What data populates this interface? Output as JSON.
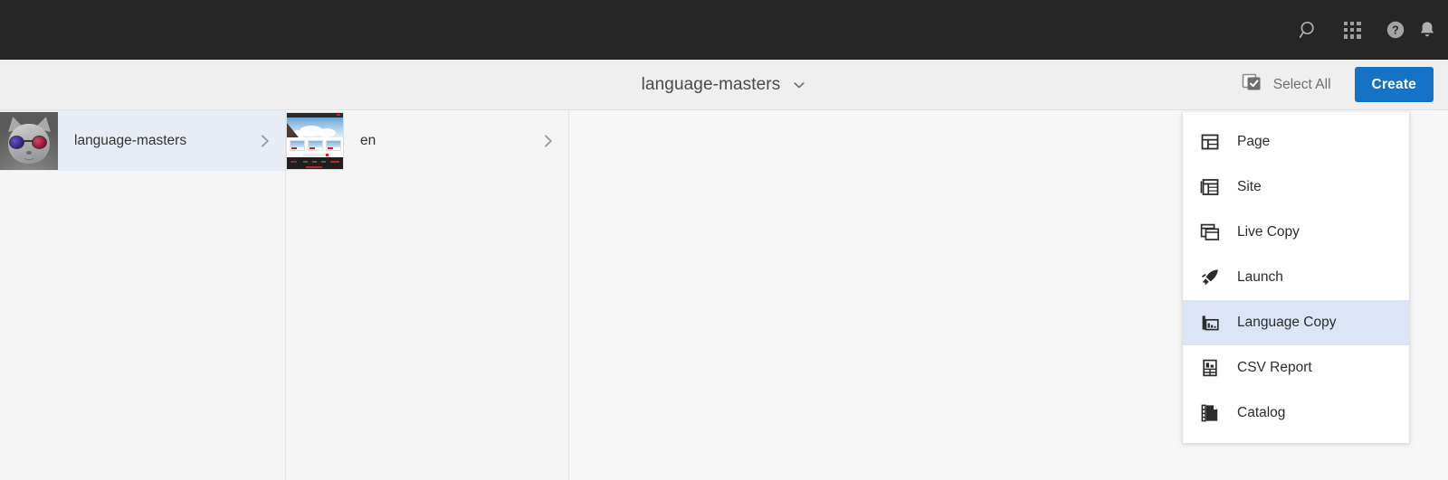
{
  "shell": {
    "background": "#262626",
    "icons": [
      {
        "name": "search-icon",
        "label": "Search"
      },
      {
        "name": "solutions-grid-icon",
        "label": "Solutions"
      },
      {
        "name": "help-icon",
        "label": "Help"
      },
      {
        "name": "notifications-bell-icon",
        "label": "Notifications"
      }
    ]
  },
  "action_bar": {
    "title": "language-masters",
    "title_caret": "chevron-down-icon",
    "select_all_label": "Select All",
    "create_label": "Create",
    "create_color": "#1473c4",
    "background": "#efefef"
  },
  "columns": [
    {
      "name": "column-root",
      "items": [
        {
          "label": "language-masters",
          "thumbnail": "cat-sunglasses-thumbnail",
          "selected": true,
          "has_children": true
        }
      ]
    },
    {
      "name": "column-language-masters",
      "items": [
        {
          "label": "en",
          "thumbnail": "website-page-thumbnail",
          "selected": false,
          "has_children": true
        }
      ]
    },
    {
      "name": "column-empty",
      "items": []
    }
  ],
  "create_menu": {
    "selected_index": 4,
    "highlight_color": "#dce5f5",
    "items": [
      {
        "label": "Page",
        "icon": "page-icon"
      },
      {
        "label": "Site",
        "icon": "site-icon"
      },
      {
        "label": "Live Copy",
        "icon": "live-copy-icon"
      },
      {
        "label": "Launch",
        "icon": "launch-rocket-icon"
      },
      {
        "label": "Language Copy",
        "icon": "language-copy-icon"
      },
      {
        "label": "CSV Report",
        "icon": "csv-report-icon"
      },
      {
        "label": "Catalog",
        "icon": "catalog-icon"
      }
    ]
  }
}
